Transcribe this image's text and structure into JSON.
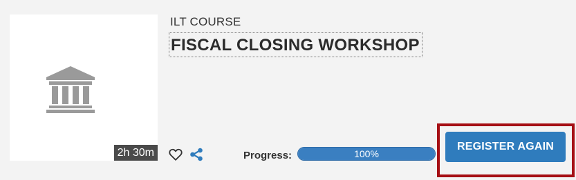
{
  "course": {
    "type": "ILT COURSE",
    "title": "FISCAL CLOSING WORKSHOP",
    "duration": "2h 30m",
    "thumbnail_icon": "bank-building-icon"
  },
  "actions": {
    "favorite_icon": "heart-outline-icon",
    "share_icon": "share-icon"
  },
  "progress": {
    "label": "Progress:",
    "percent": 100,
    "text": "100%"
  },
  "register": {
    "label": "REGISTER AGAIN"
  },
  "colors": {
    "accent": "#2f7cbd",
    "highlight": "#a50f14",
    "icon_gray": "#9a9a9a"
  }
}
